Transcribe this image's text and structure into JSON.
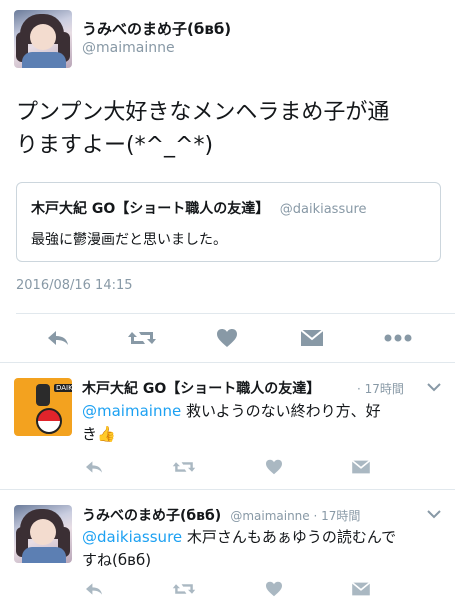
{
  "main_tweet": {
    "display_name": "うみべのまめ子(бвб)",
    "handle": "@maimainne",
    "text_line1": "プンプン大好きなメンヘラまめ子が通",
    "text_line2": "りますよー(*^_^*)",
    "timestamp": "2016/08/16 14:15"
  },
  "quoted_tweet": {
    "display_name": "木戸大紀 GO【ショート職人の友達】",
    "handle": "@daikiassure",
    "text": "最強に鬱漫画だと思いました。"
  },
  "reply1": {
    "display_name": "木戸大紀 GO【ショート職人の友達】",
    "time": "· 17時間",
    "mention": "@maimainne",
    "text_rest": " 救いようのない終わり方、好",
    "text_line2": "き👍"
  },
  "reply2": {
    "display_name": "うみべのまめ子(бвб)",
    "handle_time": "@maimainne · 17時間",
    "mention": "@daikiassure",
    "text_rest": " 木戸さんもあぁゆうの読むんで",
    "text_line2": "すね(бвб)"
  },
  "colors": {
    "action_gray": "#8899a6",
    "link_blue": "#1da1f2",
    "divider": "#e1e8ed"
  },
  "icons": [
    "reply-icon",
    "retweet-icon",
    "like-icon",
    "dm-icon",
    "more-icon",
    "chevron-down-icon"
  ]
}
